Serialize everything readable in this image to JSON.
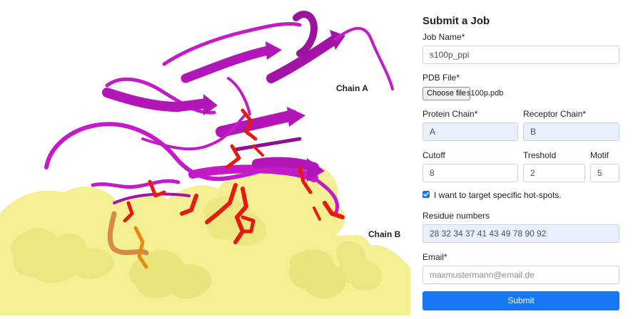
{
  "figure": {
    "chain_a_label": "Chain A",
    "chain_b_label": "Chain B",
    "colors": {
      "ribbon": "#c41bc9",
      "ribbon_dark": "#7a0e80",
      "surface": "#f3ef92",
      "surface_shade": "#d9d36a",
      "hotspot": "#e41b10",
      "hotspot_alt": "#e88a10"
    }
  },
  "form": {
    "title": "Submit a Job",
    "job_name": {
      "label": "Job Name*",
      "value": "s100p_ppi"
    },
    "pdb_file": {
      "label": "PDB File*",
      "button": "Choose file",
      "filename": "s100p.pdb"
    },
    "protein_chain": {
      "label": "Protein Chain*",
      "value": "A"
    },
    "receptor_chain": {
      "label": "Receptor Chain*",
      "value": "B"
    },
    "cutoff": {
      "label": "Cutoff",
      "value": "8"
    },
    "threshold": {
      "label": "Treshold",
      "value": "2"
    },
    "motif": {
      "label": "Motif",
      "value": "5"
    },
    "hotspot_checkbox": {
      "label": "I want to target specific hot-spots.",
      "checked": true
    },
    "residue_numbers": {
      "label": "Residue numbers",
      "value": "28 32 34 37 41 43 49 78 90 92"
    },
    "email": {
      "label": "Email*",
      "placeholder": "maxmustermann@email.de"
    },
    "submit_label": "Submit",
    "accent_color": "#1877f2"
  }
}
